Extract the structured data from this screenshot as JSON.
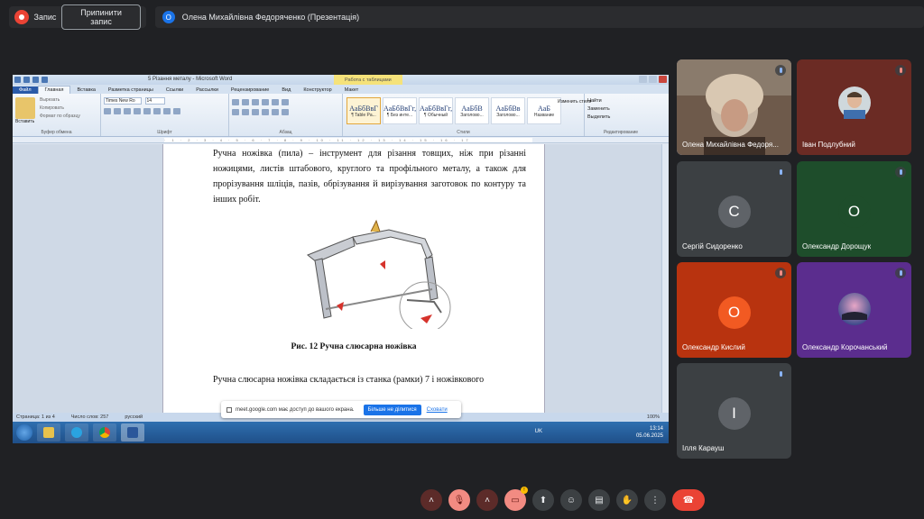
{
  "top_bar": {
    "recording_label": "Запис",
    "stop_recording_label": "Припинити запис",
    "presenter_initial": "О",
    "presenter_label": "Олена Михайлівна Федоряченко (Презентація)"
  },
  "word": {
    "title": "5 Різання металу - Microsoft Word",
    "table_tools": "Работа с таблицами",
    "tabs": [
      "Файл",
      "Главная",
      "Вставка",
      "Разметка страницы",
      "Ссылки",
      "Рассылки",
      "Рецензирование",
      "Вид",
      "Конструктор",
      "Макет"
    ],
    "clipboard": {
      "paste": "Вставить",
      "cut": "Вырезать",
      "copy": "Копировать",
      "format": "Формат по образцу",
      "group": "Буфер обмена"
    },
    "font": {
      "name": "Times New Ro",
      "size": "14",
      "group": "Шрифт"
    },
    "paragraph_group": "Абзац",
    "styles_group": "Стили",
    "styles": [
      {
        "sample": "AaБбВвГ",
        "name": "¶ Table Pa..."
      },
      {
        "sample": "AaБбВвГг,",
        "name": "¶ Без инте..."
      },
      {
        "sample": "AaБбВвГг,",
        "name": "¶ Обычный"
      },
      {
        "sample": "AaБбВ",
        "name": "Заголово..."
      },
      {
        "sample": "AaБбВв",
        "name": "Заголово..."
      },
      {
        "sample": "AaБ",
        "name": "Название"
      }
    ],
    "change_styles": "Изменить стили",
    "editing": {
      "find": "Найти",
      "replace": "Заменить",
      "select": "Выделить",
      "group": "Редактирование"
    },
    "paragraph1": "Ручна ножівка (пила) – інструмент для різання товщих, ніж при різанні ножицями, листів штабового, круглого та профільного металу, а також для прорізування шліців, пазів, обрізування й вирізування заготовок по контуру та інших робіт.",
    "caption": "Рис. 12   Ручна слюсарна ножівка",
    "paragraph2": "Ручна слюсарна ножівка складається із станка (рамки) 7 і ножівкового",
    "status": {
      "page": "Страница: 1 из 4",
      "words": "Число слов: 257",
      "lang": "русский",
      "zoom": "100%"
    }
  },
  "share_notice": {
    "text": "meet.google.com має доступ до вашого екрана.",
    "stop": "Більше не ділитися",
    "hide": "Сховати"
  },
  "taskbar": {
    "lang": "UK",
    "time": "13:14",
    "date": "05.06.2025"
  },
  "participants": [
    {
      "name": "Олена Михайлівна Федоря...",
      "initial": "",
      "muted": false
    },
    {
      "name": "Іван Подлубний",
      "initial": "",
      "muted": true
    },
    {
      "name": "Сергій Сидоренко",
      "initial": "С",
      "muted": true
    },
    {
      "name": "Олександр Дорощук",
      "initial": "О",
      "muted": true
    },
    {
      "name": "Олександр Кислий",
      "initial": "О",
      "muted": true
    },
    {
      "name": "Олександр Корочанський",
      "initial": "",
      "muted": false
    },
    {
      "name": "Ілля Карауш",
      "initial": "І",
      "muted": true
    }
  ],
  "colors": {
    "meet_bg": "#202124",
    "tile_brown": "#6b2b24",
    "tile_grey": "#3c4043",
    "tile_green": "#1e4d2b",
    "tile_orange": "#b8330f",
    "tile_purple": "#5b2d8e",
    "avatar_orange": "#f25a22",
    "hangup": "#ea4335"
  },
  "controls": {
    "icons": [
      "chevron-up-icon",
      "mic-off-icon",
      "chevron-up-icon",
      "camera-off-icon",
      "present-icon",
      "emoji-icon",
      "captions-icon",
      "raise-hand-icon",
      "more-icon",
      "hangup-icon"
    ],
    "camera_badge": "!"
  }
}
